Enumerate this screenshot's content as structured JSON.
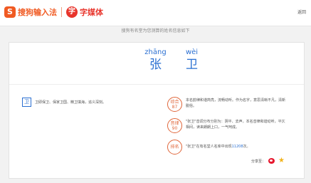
{
  "header": {
    "logo_text": "搜狗输入法",
    "logo2_icon": "字",
    "logo2_text": "字媒体",
    "back_label": "返回"
  },
  "subtitle": "搜狗有名堂为您测算的姓名信息如下",
  "name": {
    "chars": [
      {
        "pinyin": "zhāng",
        "hanzi": "张"
      },
      {
        "pinyin": "wèi",
        "hanzi": "卫"
      }
    ]
  },
  "meaning": {
    "badge": "卫",
    "text": "卫即保卫、保家卫国、精卫填海，追义深刻。"
  },
  "scores": [
    {
      "label": "综合",
      "value": "87",
      "text": "本名韵律和谐简亮，流畅动听。作为名字，意思清晰不凡，清新脱俗。"
    },
    {
      "label": "音律",
      "value": "90",
      "text": "\"张卫\"音调分布分别为：阴平、去声。本名音律和谐动听，平仄相间，读来朗朗上口，一气呵成。"
    },
    {
      "label": "排名",
      "value": "",
      "text_prefix": "\"张卫\"在有名堂人名库中出现",
      "count": "11208",
      "text_suffix": "次。"
    }
  ],
  "share": {
    "label": "分享至：",
    "icons": [
      "weibo-icon",
      "star-icon"
    ]
  },
  "colors": {
    "brand_orange": "#f05a22",
    "name_blue": "#2a6fd1",
    "score_ring": "#e0663a"
  }
}
